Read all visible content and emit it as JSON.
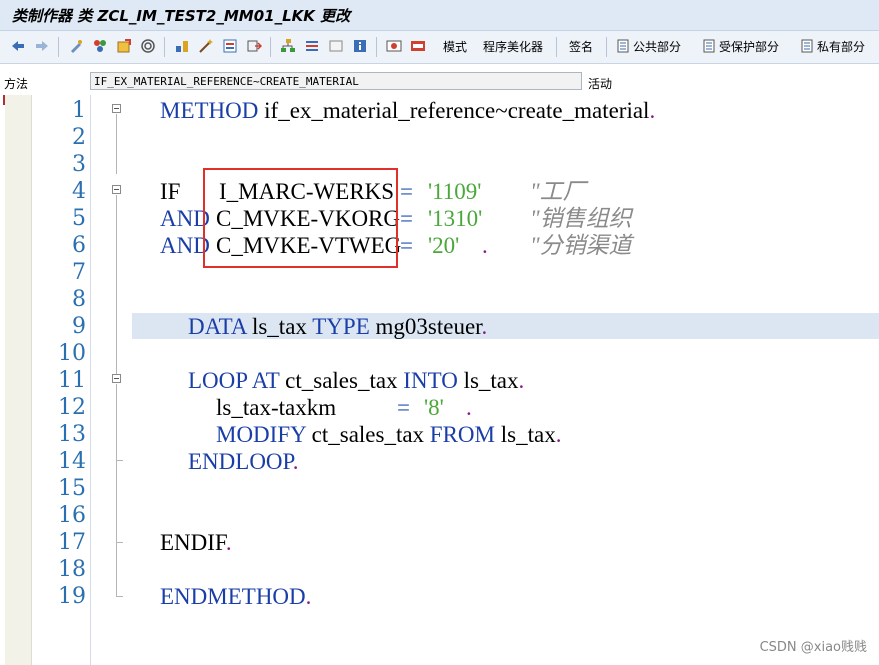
{
  "window": {
    "title": "类制作器 类 ZCL_IM_TEST2_MM01_LKK 更改"
  },
  "toolbar": {
    "mode_label": "模式",
    "pretty_printer_label": "程序美化器",
    "signature_label": "签名",
    "public_section_label": "公共部分",
    "protected_section_label": "受保护部分",
    "private_section_label": "私有部分"
  },
  "method_field": {
    "label": "方法",
    "value": "IF_EX_MATERIAL_REFERENCE~CREATE_MATERIAL",
    "status": "活动"
  },
  "editor": {
    "line_numbers": [
      "1",
      "2",
      "3",
      "4",
      "5",
      "6",
      "7",
      "8",
      "9",
      "10",
      "11",
      "12",
      "13",
      "14",
      "15",
      "16",
      "17",
      "18",
      "19"
    ],
    "lines": {
      "l1": {
        "kw": "METHOD",
        "rest": " if_ex_material_reference~create_material",
        "dot": "."
      },
      "l4": {
        "kw": "IF",
        "field": "I_MARC-WERKS",
        "eq": "=",
        "str": "'1109'",
        "cmt": "\"工厂"
      },
      "l5": {
        "kw": "AND",
        "field": "C_MVKE-VKORG",
        "eq": "=",
        "str": "'1310'",
        "cmt": "\"销售组织"
      },
      "l6": {
        "kw": "AND",
        "field": "C_MVKE-VTWEG",
        "eq": "=",
        "str": "'20'",
        "dot": ".",
        "cmt": "\"分销渠道"
      },
      "l9": {
        "kw1": "DATA",
        "mid": " ls_tax ",
        "kw2": "TYPE",
        "rest": " mg03steuer",
        "dot": "."
      },
      "l11": {
        "kw1": "LOOP AT",
        "mid": " ct_sales_tax ",
        "kw2": "INTO",
        "rest": " ls_tax",
        "dot": "."
      },
      "l12": {
        "rest": "ls_tax-taxkm",
        "eq": "=",
        "str": "'8'",
        "dot": "."
      },
      "l13": {
        "kw1": "MODIFY",
        "mid": " ct_sales_tax ",
        "kw2": "FROM",
        "rest": " ls_tax",
        "dot": "."
      },
      "l14": {
        "kw": "ENDLOOP",
        "dot": "."
      },
      "l17": {
        "kw": "ENDIF",
        "dot": "."
      },
      "l19": {
        "kw": "ENDMETHOD",
        "dot": "."
      }
    }
  },
  "watermark": "CSDN @xiao贱贱",
  "colors": {
    "keyword": "#1a3ea8",
    "string": "#4aa83a",
    "comment": "#8a8a8a",
    "highlight": "#dbe6f2",
    "annotation_box": "#e0302a"
  }
}
